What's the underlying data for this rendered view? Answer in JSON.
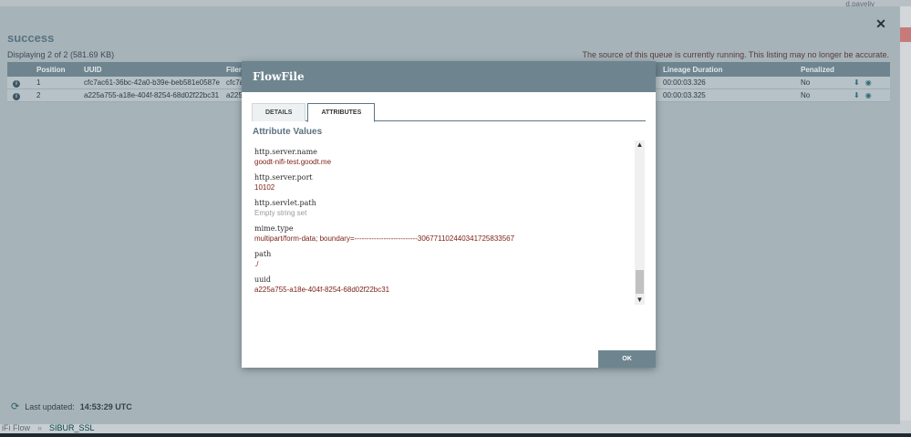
{
  "app": {
    "user": "d.paveliv",
    "breadcrumb": {
      "root": "iFi Flow",
      "separator": "»",
      "current": "SIBUR_SSL"
    }
  },
  "queue": {
    "title": "success",
    "count_text": "Displaying 2 of 2 (581.69 KB)",
    "warning": "The source of this queue is currently running. This listing may no longer be accurate.",
    "columns": {
      "position": "Position",
      "uuid": "UUID",
      "filename": "Filena",
      "lineage": "Lineage Duration",
      "penalized": "Penalized"
    },
    "rows": [
      {
        "position": "1",
        "uuid": "cfc7ac61-36bc-42a0-b39e-beb581e0587e",
        "filename": "cfc7a",
        "lineage": "00:00:03.326",
        "penalized": "No"
      },
      {
        "position": "2",
        "uuid": "a225a755-a18e-404f-8254-68d02f22bc31",
        "filename": "a225",
        "lineage": "00:00:03.325",
        "penalized": "No"
      }
    ],
    "last_updated_label": "Last updated:",
    "last_updated_time": "14:53:29 UTC"
  },
  "flowfile": {
    "title": "FlowFile",
    "tabs": {
      "details": "DETAILS",
      "attributes": "ATTRIBUTES"
    },
    "section_title": "Attribute Values",
    "attributes": [
      {
        "name": "http.server.name",
        "value": "goodt-nifi-test.goodt.me"
      },
      {
        "name": "http.server.port",
        "value": "10102"
      },
      {
        "name": "http.servlet.path",
        "value": "Empty string set"
      },
      {
        "name": "mime.type",
        "value": "multipart/form-data; boundary=--------------------------306771102440341725833567"
      },
      {
        "name": "path",
        "value": "./"
      },
      {
        "name": "uuid",
        "value": "a225a755-a18e-404f-8254-68d02f22bc31"
      }
    ],
    "ok_label": "OK"
  },
  "icons": {
    "close": "close-icon",
    "refresh": "refresh-icon",
    "info": "info-icon",
    "download": "download-icon",
    "view": "eye-icon"
  }
}
